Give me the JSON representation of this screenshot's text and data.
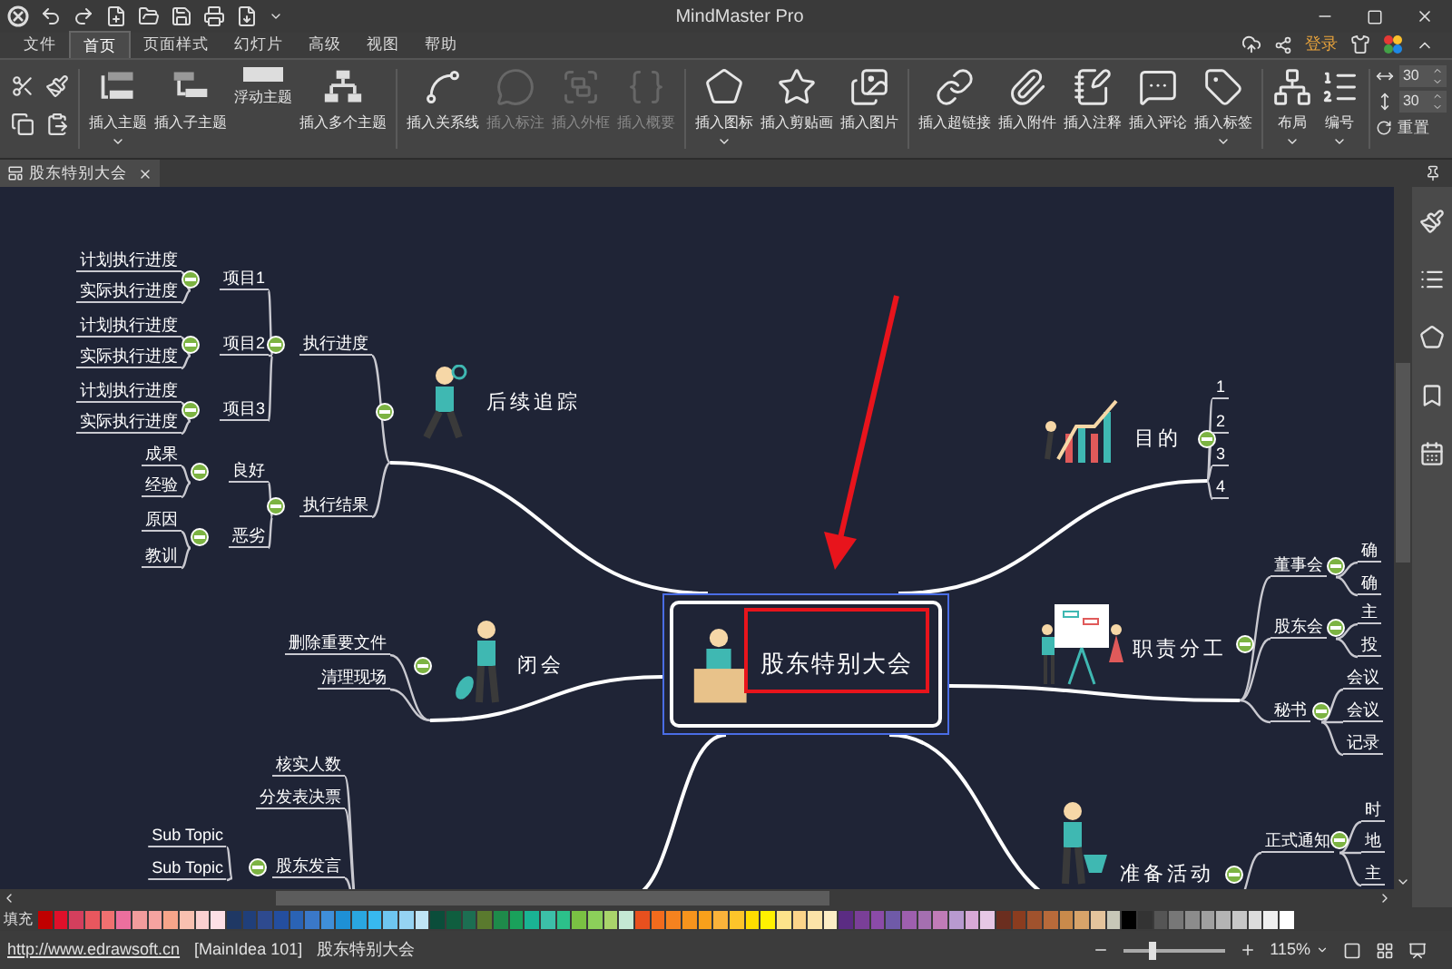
{
  "window": {
    "title": "MindMaster Pro"
  },
  "menu_tabs": [
    {
      "label": "文件",
      "selected": false
    },
    {
      "label": "首页",
      "selected": true
    },
    {
      "label": "页面样式",
      "selected": false
    },
    {
      "label": "幻灯片",
      "selected": false
    },
    {
      "label": "高级",
      "selected": false
    },
    {
      "label": "视图",
      "selected": false
    },
    {
      "label": "帮助",
      "selected": false
    }
  ],
  "account": {
    "login": "登录"
  },
  "ribbon": {
    "groups": [
      {
        "buttons": [
          {
            "label": "插入主题",
            "dropdown": true,
            "disabled": false
          },
          {
            "label": "插入子主题",
            "dropdown": false,
            "disabled": false
          },
          {
            "label": "浮动主题",
            "dropdown": false,
            "disabled": false
          },
          {
            "label": "插入多个主题",
            "dropdown": false,
            "disabled": false
          }
        ]
      },
      {
        "buttons": [
          {
            "label": "插入关系线",
            "dropdown": false,
            "disabled": false
          },
          {
            "label": "插入标注",
            "dropdown": false,
            "disabled": true
          },
          {
            "label": "插入外框",
            "dropdown": false,
            "disabled": true
          },
          {
            "label": "插入概要",
            "dropdown": false,
            "disabled": true
          }
        ]
      },
      {
        "buttons": [
          {
            "label": "插入图标",
            "dropdown": true,
            "disabled": false
          },
          {
            "label": "插入剪贴画",
            "dropdown": false,
            "disabled": false
          },
          {
            "label": "插入图片",
            "dropdown": false,
            "disabled": false
          }
        ]
      },
      {
        "buttons": [
          {
            "label": "插入超链接",
            "dropdown": false,
            "disabled": false
          },
          {
            "label": "插入附件",
            "dropdown": false,
            "disabled": false
          },
          {
            "label": "插入注释",
            "dropdown": false,
            "disabled": false
          },
          {
            "label": "插入评论",
            "dropdown": false,
            "disabled": false
          },
          {
            "label": "插入标签",
            "dropdown": true,
            "disabled": false
          }
        ]
      },
      {
        "buttons": [
          {
            "label": "布局",
            "dropdown": true,
            "disabled": false
          },
          {
            "label": "编号",
            "dropdown": true,
            "disabled": false
          }
        ]
      }
    ],
    "spacing": [
      {
        "value": "30"
      },
      {
        "value": "30"
      }
    ],
    "reset": "重置"
  },
  "document_tab": {
    "title": "股东特别大会"
  },
  "mind_map": {
    "central_topic": "股东特别大会",
    "branches": [
      {
        "label": "后续追踪",
        "expanded": true,
        "children": [
          {
            "label": "执行进度",
            "expanded": true,
            "children": [
              {
                "label": "项目1",
                "expanded": true,
                "children": [
                  {
                    "label": "计划执行进度"
                  },
                  {
                    "label": "实际执行进度"
                  }
                ]
              },
              {
                "label": "项目2",
                "expanded": true,
                "children": [
                  {
                    "label": "计划执行进度"
                  },
                  {
                    "label": "实际执行进度"
                  }
                ]
              },
              {
                "label": "项目3",
                "expanded": true,
                "children": [
                  {
                    "label": "计划执行进度"
                  },
                  {
                    "label": "实际执行进度"
                  }
                ]
              }
            ]
          },
          {
            "label": "执行结果",
            "expanded": true,
            "children": [
              {
                "label": "良好",
                "expanded": true,
                "children": [
                  {
                    "label": "成果"
                  },
                  {
                    "label": "经验"
                  }
                ]
              },
              {
                "label": "恶劣",
                "expanded": true,
                "children": [
                  {
                    "label": "原因"
                  },
                  {
                    "label": "教训"
                  }
                ]
              }
            ]
          }
        ]
      },
      {
        "label": "闭会",
        "expanded": true,
        "children": [
          {
            "label": "删除重要文件"
          },
          {
            "label": "清理现场"
          }
        ]
      },
      {
        "children": [
          {
            "label": "核实人数"
          },
          {
            "label": "分发表决票"
          },
          {
            "label": "股东发言",
            "expanded": true,
            "children": [
              {
                "label": "Sub Topic"
              },
              {
                "label": "Sub Topic"
              }
            ]
          }
        ]
      },
      {
        "label": "目的",
        "expanded": true,
        "children": [
          {
            "label": "1"
          },
          {
            "label": "2"
          },
          {
            "label": "3"
          },
          {
            "label": "4"
          }
        ]
      },
      {
        "label": "职责分工",
        "expanded": true,
        "children": [
          {
            "label": "董事会",
            "expanded": true,
            "children": [
              {
                "label": "确"
              },
              {
                "label": "确"
              }
            ]
          },
          {
            "label": "股东会",
            "expanded": true,
            "children": [
              {
                "label": "主"
              },
              {
                "label": "投"
              }
            ]
          },
          {
            "label": "秘书",
            "expanded": true,
            "children": [
              {
                "label": "会议"
              },
              {
                "label": "会议"
              },
              {
                "label": "记录"
              }
            ]
          }
        ]
      },
      {
        "label": "准备活动",
        "expanded": true,
        "children": [
          {
            "label": "正式通知",
            "expanded": true,
            "children": [
              {
                "label": "时"
              },
              {
                "label": "地"
              },
              {
                "label": "主"
              }
            ]
          }
        ]
      }
    ]
  },
  "palette": {
    "label": "填充",
    "colors": [
      {
        "color": "#c00000"
      },
      {
        "color": "#e0102a"
      },
      {
        "color": "#d43f5d"
      },
      {
        "color": "#e8575e"
      },
      {
        "color": "#f07070"
      },
      {
        "color": "#ec6f9e"
      },
      {
        "color": "#f29c9c"
      },
      {
        "color": "#f5a3a0"
      },
      {
        "color": "#f7a58a"
      },
      {
        "color": "#f9c0b0"
      },
      {
        "color": "#fbd0d0"
      },
      {
        "color": "#fde0e6"
      },
      {
        "color": "#1f3864"
      },
      {
        "color": "#203f7a"
      },
      {
        "color": "#2e4a8f"
      },
      {
        "color": "#244e9f"
      },
      {
        "color": "#2a63b5"
      },
      {
        "color": "#3a78c8"
      },
      {
        "color": "#3f8fd9"
      },
      {
        "color": "#1e90d6"
      },
      {
        "color": "#2aa7e0"
      },
      {
        "color": "#37b9ef"
      },
      {
        "color": "#6ec6f0"
      },
      {
        "color": "#95d3f2"
      },
      {
        "color": "#c0e4f5"
      },
      {
        "color": "#0b4d3a"
      },
      {
        "color": "#0f5e3f"
      },
      {
        "color": "#1c6e52"
      },
      {
        "color": "#5a7a2e"
      },
      {
        "color": "#1e8a4a"
      },
      {
        "color": "#1aa15b"
      },
      {
        "color": "#1ab394"
      },
      {
        "color": "#3cbfa8"
      },
      {
        "color": "#2cc08a"
      },
      {
        "color": "#7ac143"
      },
      {
        "color": "#8ccf5a"
      },
      {
        "color": "#a9d46b"
      },
      {
        "color": "#c4e8d4"
      },
      {
        "color": "#e8501e"
      },
      {
        "color": "#f26b1d"
      },
      {
        "color": "#f5821f"
      },
      {
        "color": "#f7941d"
      },
      {
        "color": "#f9a01b"
      },
      {
        "color": "#fbb33a"
      },
      {
        "color": "#fdc52a"
      },
      {
        "color": "#ffdd00"
      },
      {
        "color": "#fff100"
      },
      {
        "color": "#fde38a"
      },
      {
        "color": "#fbd58a"
      },
      {
        "color": "#fce3a8"
      },
      {
        "color": "#fdeec5"
      },
      {
        "color": "#5b2c83"
      },
      {
        "color": "#7a3f98"
      },
      {
        "color": "#8b4ba8"
      },
      {
        "color": "#6f5aa8"
      },
      {
        "color": "#9e5fae"
      },
      {
        "color": "#a46fb0"
      },
      {
        "color": "#c07bb7"
      },
      {
        "color": "#b89ad0"
      },
      {
        "color": "#d7a9d6"
      },
      {
        "color": "#e6c7e5"
      },
      {
        "color": "#6b2e1f"
      },
      {
        "color": "#8a3c1f"
      },
      {
        "color": "#a0522d"
      },
      {
        "color": "#b86a3a"
      },
      {
        "color": "#c98a4b"
      },
      {
        "color": "#d8a46a"
      },
      {
        "color": "#e4c49c"
      },
      {
        "color": "#c8c8b8"
      },
      {
        "color": "#000000"
      },
      {
        "color": "#333333"
      },
      {
        "color": "#555555"
      },
      {
        "color": "#777777"
      },
      {
        "color": "#8c8c8c"
      },
      {
        "color": "#a0a0a0"
      },
      {
        "color": "#b4b4b4"
      },
      {
        "color": "#c8c8c8"
      },
      {
        "color": "#dcdcdc"
      },
      {
        "color": "#f0f0f0"
      },
      {
        "color": "#ffffff"
      }
    ]
  },
  "status_bar": {
    "link": "http://www.edrawsoft.cn",
    "selection": "[MainIdea 101]",
    "document": "股东特别大会",
    "zoom": {
      "level": 0.3,
      "reading": "115%"
    }
  }
}
